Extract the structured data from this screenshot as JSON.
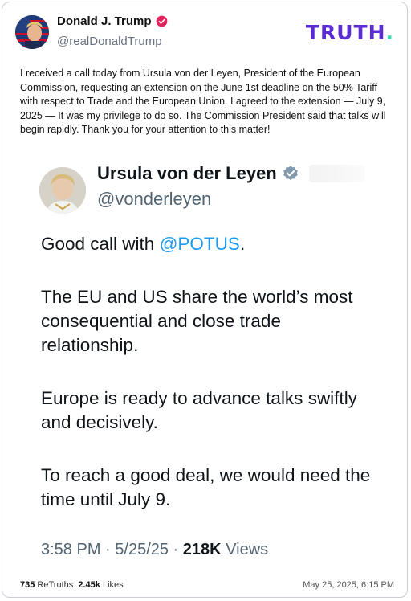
{
  "post": {
    "author_name": "Donald J. Trump",
    "author_handle": "@realDonaldTrump",
    "brand_prefix": "TRUTH",
    "brand_dot": ".",
    "text": "I received a call today from Ursula von der Leyen, President of the European Commission, requesting an extension on the June 1st deadline on the 50% Tariff with respect to Trade and the European Union. I agreed to the extension — July 9, 2025 — It was my privilege to do so. The Commission President said that talks will begin rapidly. Thank you for your attention to this matter!",
    "retruths_count": "735",
    "retruths_label": "ReTruths",
    "likes_count": "2.45k",
    "likes_label": "Likes",
    "date": "May 25, 2025, 6:15 PM"
  },
  "quote": {
    "author_name": "Ursula von der Leyen",
    "author_handle": "@vonderleyen",
    "p1_text": "Good call with ",
    "p1_mention": "@POTUS",
    "p1_end": ".",
    "p2": "The EU and US share the world’s most consequential and close trade relationship.",
    "p3": "Europe is ready to advance talks swiftly and decisively.",
    "p4": "To reach a good deal, we would need the time until July 9.",
    "time": "3:58 PM",
    "sep1": " · ",
    "date": "5/25/25",
    "sep2": " · ",
    "views_count": "218K",
    "views_label": "Views"
  },
  "colors": {
    "brand": "#5b2bd6",
    "brand_dot": "#2ee0b5",
    "verified": "#e0245e",
    "x_verified": "#829aab",
    "mention": "#1d9bf0"
  },
  "icons": {
    "post_verified": "verified-badge-icon",
    "quote_verified": "verified-badge-icon"
  }
}
